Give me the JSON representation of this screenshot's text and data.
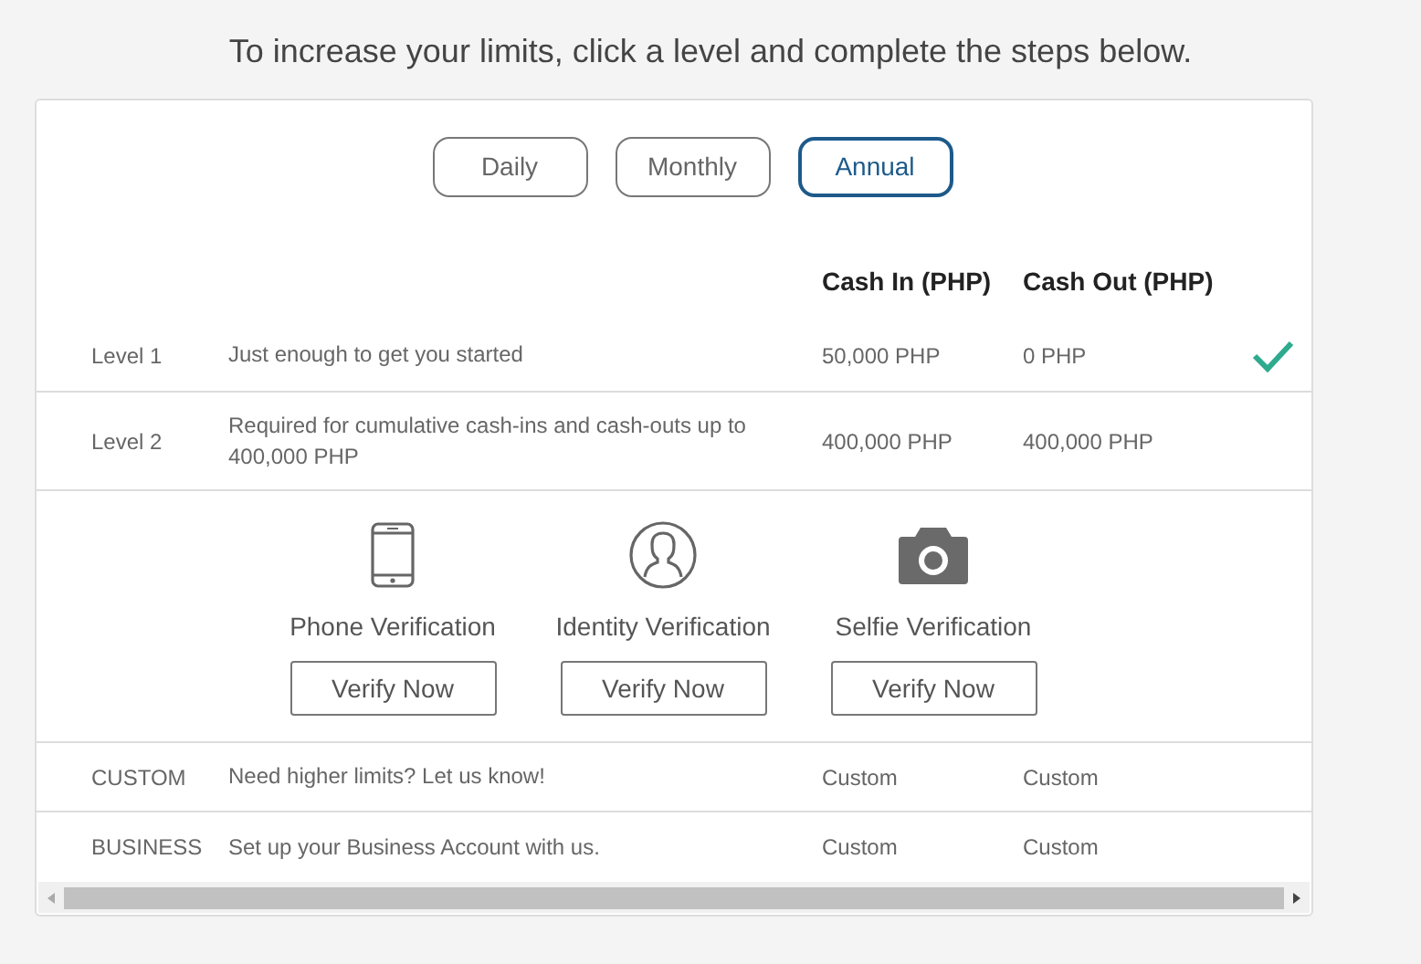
{
  "heading": "To increase your limits, click a level and complete the steps below.",
  "tabs": [
    {
      "label": "Daily",
      "selected": false
    },
    {
      "label": "Monthly",
      "selected": false
    },
    {
      "label": "Annual",
      "selected": true
    }
  ],
  "table": {
    "columns": [
      "Cash In (PHP)",
      "Cash Out (PHP)"
    ],
    "rows": [
      {
        "kind": "level",
        "level": "Level 1",
        "description": "Just enough to get you started",
        "cash_in": "50,000 PHP",
        "cash_out": "0 PHP",
        "completed": true
      },
      {
        "kind": "level",
        "level": "Level 2",
        "description": "Required for cumulative cash-ins and cash-outs up to 400,000 PHP",
        "cash_in": "400,000 PHP",
        "cash_out": "400,000 PHP",
        "completed": false
      },
      {
        "kind": "verifications",
        "items": [
          {
            "kind": "phone",
            "label": "Phone Verification",
            "button": "Verify Now"
          },
          {
            "kind": "identity",
            "label": "Identity Verification",
            "button": "Verify Now"
          },
          {
            "kind": "selfie",
            "label": "Selfie Verification",
            "button": "Verify Now"
          }
        ]
      },
      {
        "kind": "level",
        "level": "CUSTOM",
        "description": "Need higher limits? Let us know!",
        "cash_in": "Custom",
        "cash_out": "Custom",
        "completed": false
      },
      {
        "kind": "level",
        "level": "BUSINESS",
        "description": "Set up your Business Account with us.",
        "cash_in": "Custom",
        "cash_out": "Custom",
        "completed": false
      }
    ]
  }
}
